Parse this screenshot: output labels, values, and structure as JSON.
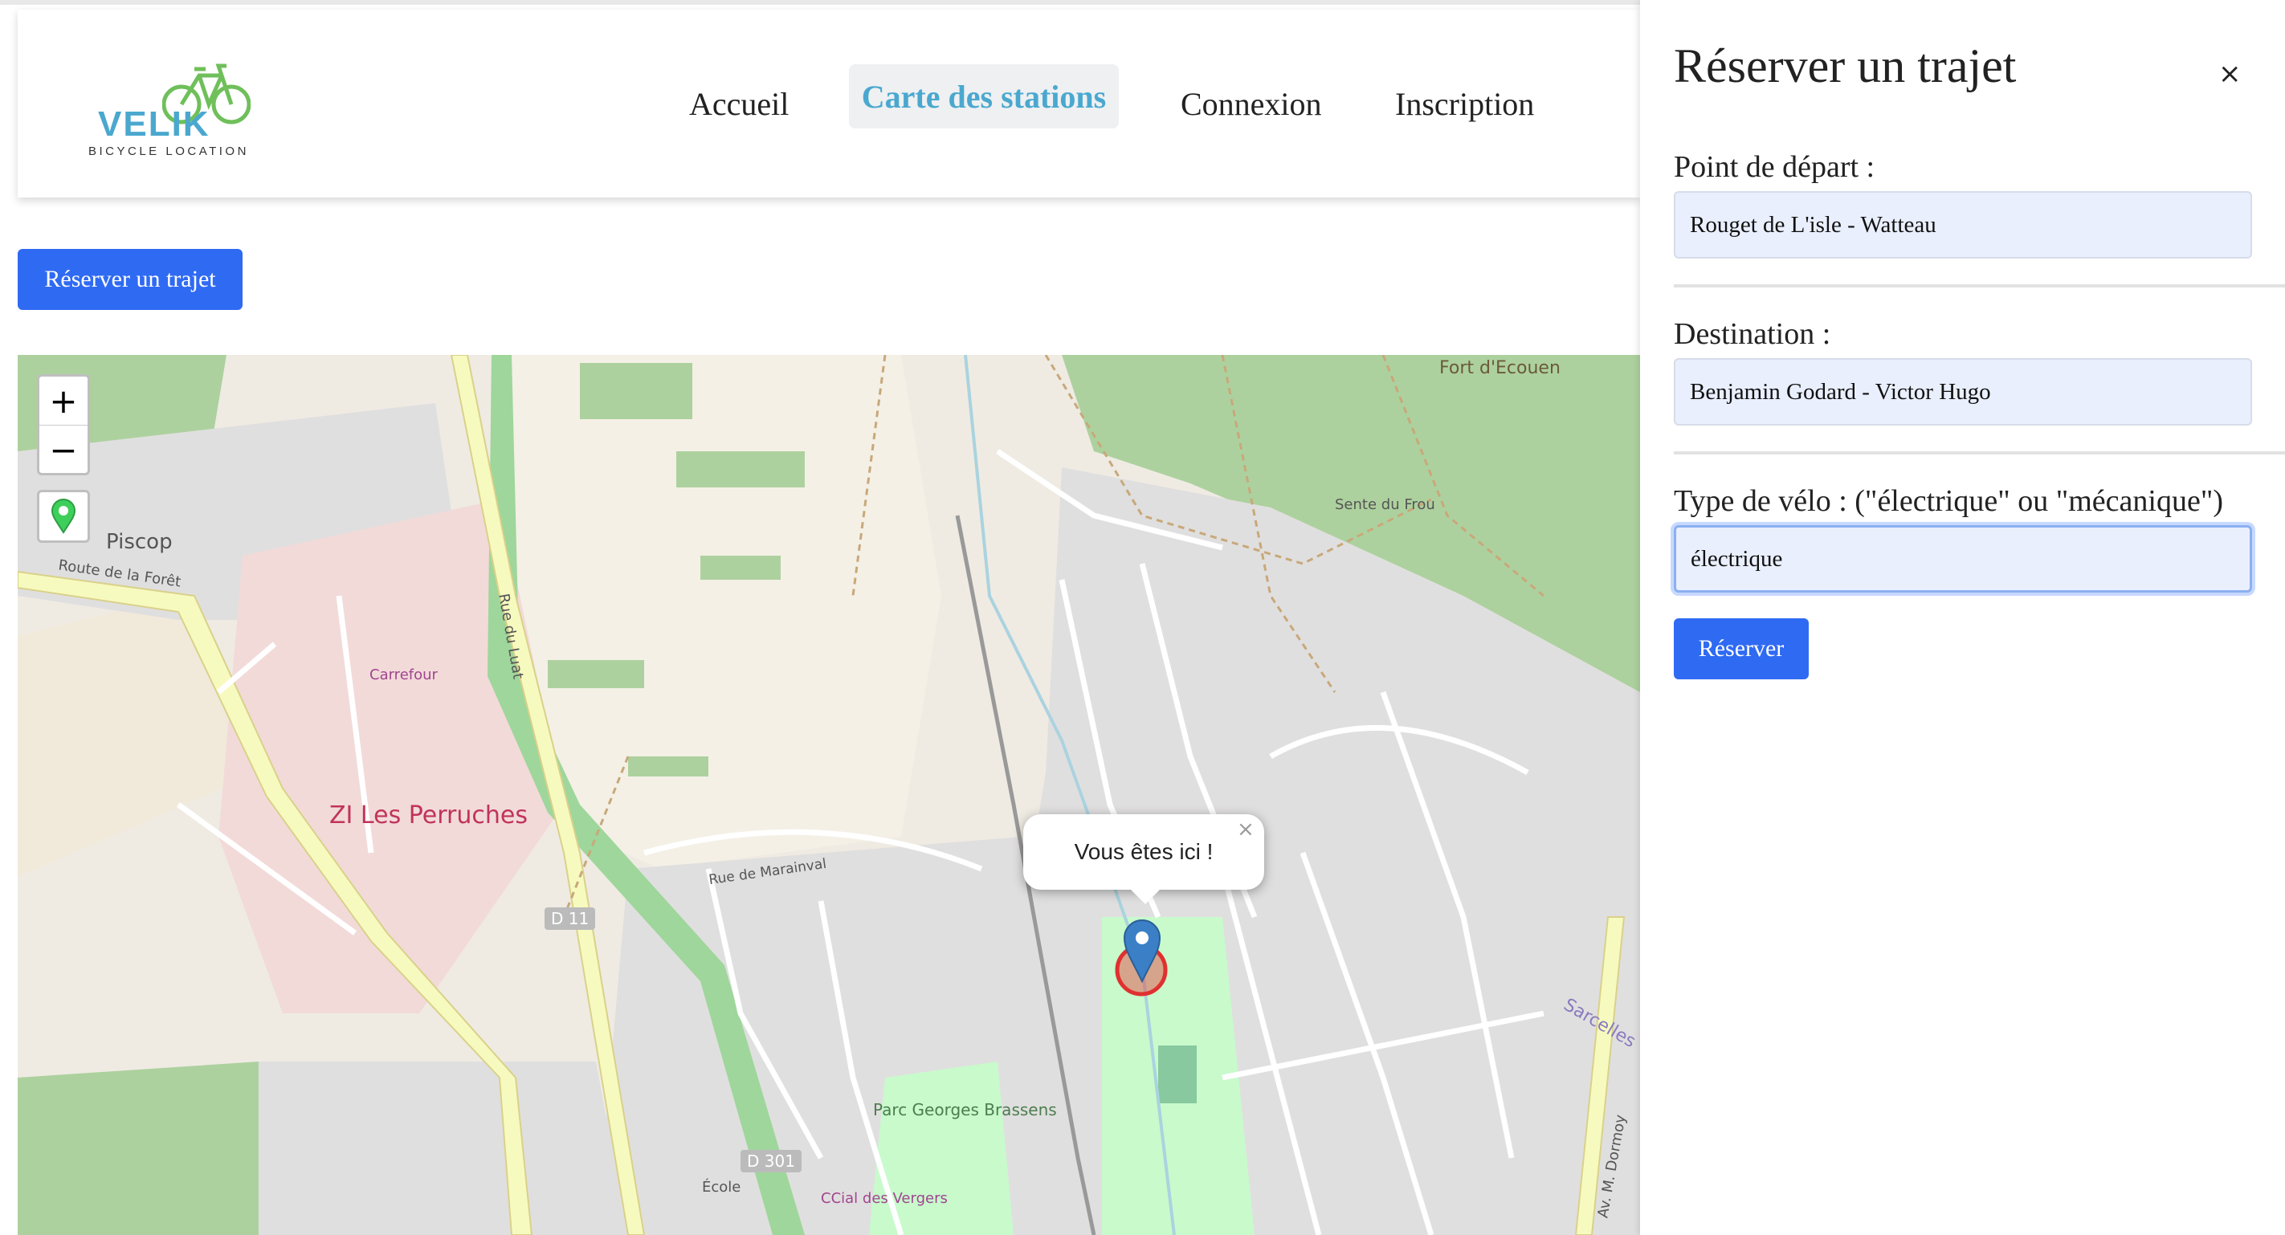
{
  "header": {
    "logo": {
      "word": "VELIK",
      "tagline": "BICYCLE LOCATION"
    },
    "nav": [
      {
        "label": "Accueil",
        "active": false
      },
      {
        "label": "Carte des stations",
        "active": true
      },
      {
        "label": "Connexion",
        "active": false
      },
      {
        "label": "Inscription",
        "active": false
      }
    ]
  },
  "main": {
    "reserve_button": "Réserver un trajet"
  },
  "map": {
    "zoom_in": "+",
    "zoom_out": "−",
    "locate_icon": "map-pin-icon",
    "popup_text": "Vous êtes ici !",
    "popup_close": "×",
    "labels": {
      "piscop": "Piscop",
      "zi": "ZI Les Perruches",
      "carrefour": "Carrefour",
      "fort": "Fort d'Ecouen",
      "parc": "Parc Georges Brassens",
      "d11": "D 11",
      "d301": "D 301",
      "sarcelles": "Sarcelles",
      "route_foret": "Route de la Forêt",
      "rue_luat": "Rue du Luat",
      "sente_frou": "Sente du Frou",
      "rue_marainval": "Rue de Marainval",
      "av_dormoy": "Av. M. Dormoy",
      "ccial": "CCial des Vergers",
      "ecole": "École"
    }
  },
  "panel": {
    "title": "Réserver un trajet",
    "close": "×",
    "departure_label": "Point de départ :",
    "departure_value": "Rouget de L'isle - Watteau",
    "destination_label": "Destination :",
    "destination_value": "Benjamin Godard - Victor Hugo",
    "bike_type_label": "Type de vélo : (\"électrique\" ou \"mécanique\")",
    "bike_type_value": "électrique",
    "submit": "Réserver"
  },
  "colors": {
    "accent": "#2f6af3",
    "brand": "#4aa8cf",
    "input_bg": "#e9effd"
  }
}
